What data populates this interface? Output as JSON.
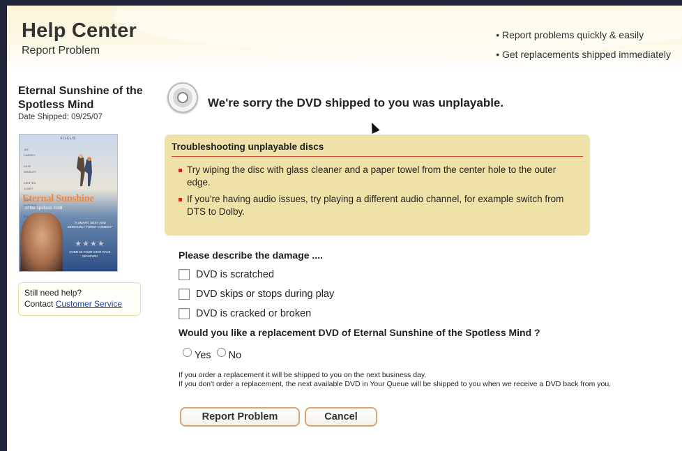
{
  "header": {
    "title": "Help Center",
    "subtitle": "Report Problem",
    "features": [
      "• Report problems quickly & easily",
      "• Get replacements shipped immediately"
    ]
  },
  "sidebar": {
    "movie_title": "Eternal Sunshine of the Spotless Mind",
    "date_shipped": "Date Shipped: 09/25/07",
    "poster": {
      "studio": "FOCUS",
      "credits": "JIM\nCARREY\n\nKATE\nWINSLET\n\nKIRSTEN\nDUNST\n\nMARK\nRUFFALO\n\nELIJAH\nWOOD",
      "logo": "Eternal Sunshine",
      "logo_sub": "of the spotless mind",
      "quote": "\"A SMART, SEXY AND SERIOUSLY FUNNY COMEDY\"",
      "stars": "★★★★",
      "reviews": "OVER 50 FOUR-STAR RAVE REVIEWS!"
    },
    "help_text": "Still need help?",
    "contact_prefix": "Contact ",
    "contact_link": "Customer Service"
  },
  "main": {
    "sorry_message": "We're sorry the DVD shipped to you was unplayable.",
    "troubleshooting": {
      "title": "Troubleshooting unplayable discs",
      "tips": [
        "Try wiping the disc with glass cleaner and a paper towel from the center hole to the outer edge.",
        "If you're having audio issues, try playing a different audio channel, for example switch from DTS to Dolby."
      ]
    },
    "damage_prompt": "Please describe the damage ....",
    "damage_options": [
      "DVD is scratched",
      "DVD skips or stops during play",
      "DVD is cracked or broken"
    ],
    "replacement_question": "Would you like a replacement DVD of Eternal Sunshine of the Spotless Mind ?",
    "yes_label": "Yes",
    "no_label": "No",
    "note_lines": [
      "If you order a replacement it will be shipped to you on the next business day.",
      "If you don't order a replacement, the next available DVD in Your Queue will be shipped to you when we receive a DVD back from you."
    ],
    "report_button": "Report Problem",
    "cancel_button": "Cancel"
  },
  "colors": {
    "background": "#23263a",
    "header_cream": "#fbf4d7",
    "trouble_box": "#efe2a9",
    "bullet_red": "#cc2a1a",
    "link_blue": "#1b3fb0",
    "button_border": "#e0a36a"
  },
  "icons": [
    "disc-icon",
    "mouse-cursor-icon"
  ]
}
